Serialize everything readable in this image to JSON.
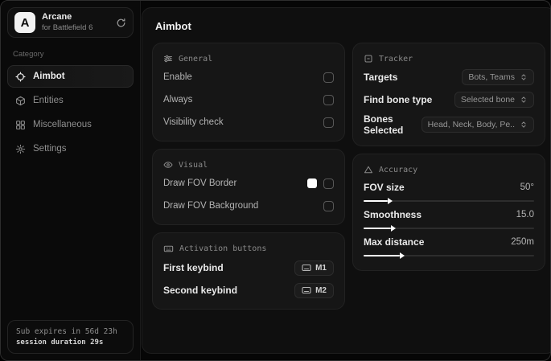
{
  "colors": {
    "accent": "#ffffff",
    "sidebar_bg": "#0a0a0a",
    "panel_bg": "#0f0f0f",
    "card_bg": "#161616"
  },
  "sidebar": {
    "logo": {
      "initial": "A",
      "title": "Arcane",
      "subtitle": "for Battlefield 6"
    },
    "category_label": "Category",
    "items": [
      {
        "label": "Aimbot",
        "icon": "crosshair-icon",
        "active": true
      },
      {
        "label": "Entities",
        "icon": "cube-icon",
        "active": false
      },
      {
        "label": "Miscellaneous",
        "icon": "grid-icon",
        "active": false
      },
      {
        "label": "Settings",
        "icon": "gear-icon",
        "active": false
      }
    ],
    "status": {
      "sub_expires": "Sub expires in 56d 23h",
      "session_duration": "session duration 29s"
    }
  },
  "main": {
    "title": "Aimbot",
    "general": {
      "title": "General",
      "rows": [
        {
          "label": "Enable",
          "checked": false
        },
        {
          "label": "Always",
          "checked": false
        },
        {
          "label": "Visibility check",
          "checked": false
        }
      ]
    },
    "visual": {
      "title": "Visual",
      "rows": [
        {
          "label": "Draw FOV Border",
          "checked": false,
          "swatch": "#ffffff"
        },
        {
          "label": "Draw FOV Background",
          "checked": false
        }
      ]
    },
    "activation": {
      "title": "Activation buttons",
      "rows": [
        {
          "label": "First keybind",
          "key": "M1"
        },
        {
          "label": "Second keybind",
          "key": "M2"
        }
      ]
    },
    "tracker": {
      "title": "Tracker",
      "rows": [
        {
          "label": "Targets",
          "value": "Bots, Teams"
        },
        {
          "label": "Find bone type",
          "value": "Selected bone"
        },
        {
          "label": "Bones Selected",
          "value": "Head, Neck, Body, Pe.."
        }
      ]
    },
    "accuracy": {
      "title": "Accuracy",
      "sliders": [
        {
          "label": "FOV size",
          "value": "50°",
          "percent": 14
        },
        {
          "label": "Smoothness",
          "value": "15.0",
          "percent": 16
        },
        {
          "label": "Max distance",
          "value": "250m",
          "percent": 21
        }
      ]
    }
  }
}
